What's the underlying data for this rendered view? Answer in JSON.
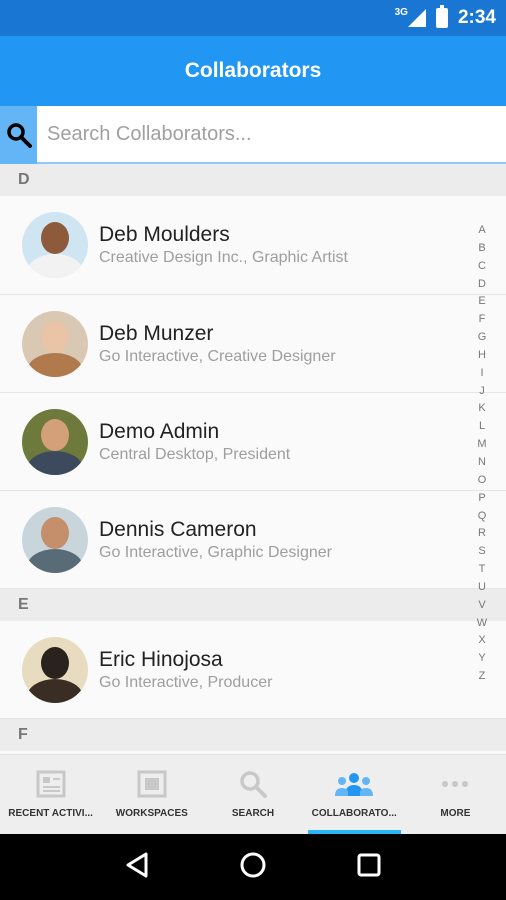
{
  "status_bar": {
    "network": "3G",
    "time": "2:34"
  },
  "app_bar": {
    "title": "Collaborators"
  },
  "search": {
    "placeholder": "Search Collaborators..."
  },
  "sections": [
    {
      "letter": "D",
      "contacts": [
        {
          "name": "Deb Moulders",
          "subtitle": "Creative Design Inc., Graphic Artist"
        },
        {
          "name": "Deb Munzer",
          "subtitle": "Go Interactive, Creative Designer"
        },
        {
          "name": "Demo Admin",
          "subtitle": "Central Desktop, President"
        },
        {
          "name": "Dennis Cameron",
          "subtitle": "Go Interactive, Graphic Designer"
        }
      ]
    },
    {
      "letter": "E",
      "contacts": [
        {
          "name": "Eric Hinojosa",
          "subtitle": "Go Interactive, Producer"
        }
      ]
    },
    {
      "letter": "F",
      "contacts": []
    }
  ],
  "alpha_index": [
    "A",
    "B",
    "C",
    "D",
    "E",
    "F",
    "G",
    "H",
    "I",
    "J",
    "K",
    "L",
    "M",
    "N",
    "O",
    "P",
    "Q",
    "R",
    "S",
    "T",
    "U",
    "V",
    "W",
    "X",
    "Y",
    "Z"
  ],
  "bottom_nav": [
    {
      "label": "RECENT ACTIVI...",
      "icon": "news-icon",
      "active": false
    },
    {
      "label": "WORKSPACES",
      "icon": "workspaces-icon",
      "active": false
    },
    {
      "label": "SEARCH",
      "icon": "search-icon",
      "active": false
    },
    {
      "label": "COLLABORATO...",
      "icon": "people-icon",
      "active": true
    },
    {
      "label": "MORE",
      "icon": "more-icon",
      "active": false
    }
  ],
  "colors": {
    "primary": "#2196f3",
    "primary_dark": "#1976d2",
    "accent": "#29b6f6"
  }
}
